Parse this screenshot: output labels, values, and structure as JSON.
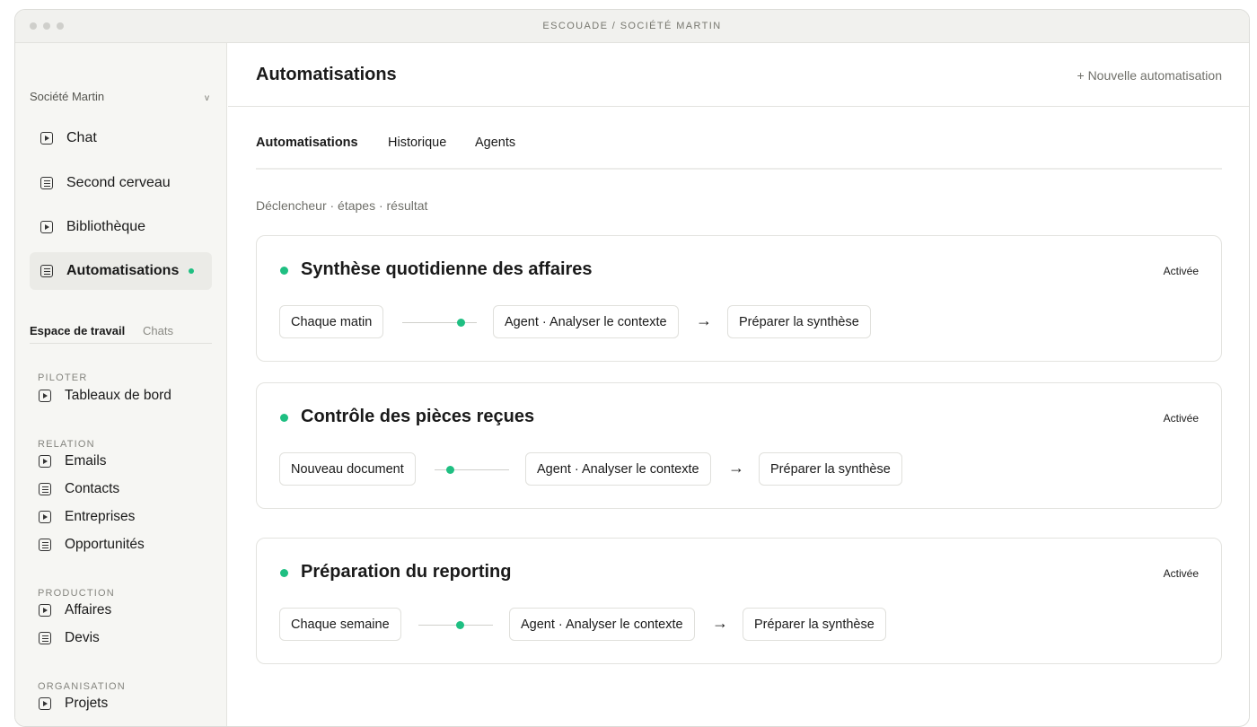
{
  "window": {
    "title": "ESCOUADE / SOCIÉTÉ MARTIN"
  },
  "sidebar": {
    "org_name": "Société Martin",
    "org_chevron": "v",
    "primary_items": [
      {
        "label": "Chat",
        "icon": "play-box-icon"
      },
      {
        "label": "Second cerveau",
        "icon": "document-icon"
      },
      {
        "label": "Bibliothèque",
        "icon": "play-box-icon"
      },
      {
        "label": "Automatisations",
        "icon": "document-icon",
        "active": true
      }
    ],
    "workspace_tabs": [
      "Espace de travail",
      "Chats"
    ],
    "sections": [
      {
        "label": "PILOTER",
        "items": [
          "Tableaux de bord"
        ]
      },
      {
        "label": "RELATION",
        "items": [
          "Emails",
          "Contacts",
          "Entreprises",
          "Opportunités"
        ]
      },
      {
        "label": "PRODUCTION",
        "items": [
          "Affaires",
          "Devis"
        ]
      },
      {
        "label": "ORGANISATION",
        "items": [
          "Projets"
        ]
      }
    ]
  },
  "main": {
    "title": "Automatisations",
    "new_button": "+ Nouvelle automatisation",
    "tabs": [
      "Automatisations",
      "Historique",
      "Agents"
    ],
    "subtitle": "Déclencheur · étapes · résultat",
    "automations": [
      {
        "title": "Synthèse quotidienne des affaires",
        "status": "Activée",
        "trigger": "Chaque matin",
        "agent": "Agent · Analyser le contexte",
        "result": "Préparer la synthèse"
      },
      {
        "title": "Contrôle des pièces reçues",
        "status": "Activée",
        "trigger": "Nouveau document",
        "agent": "Agent · Analyser le contexte",
        "result": "Préparer la synthèse"
      },
      {
        "title": "Préparation du reporting",
        "status": "Activée",
        "trigger": "Chaque semaine",
        "agent": "Agent · Analyser le contexte",
        "result": "Préparer la synthèse"
      }
    ],
    "arrow": "→"
  },
  "colors": {
    "accent": "#1fbf82",
    "active_bg": "#ebebe7",
    "sidebar_bg": "#f6f6f3"
  }
}
